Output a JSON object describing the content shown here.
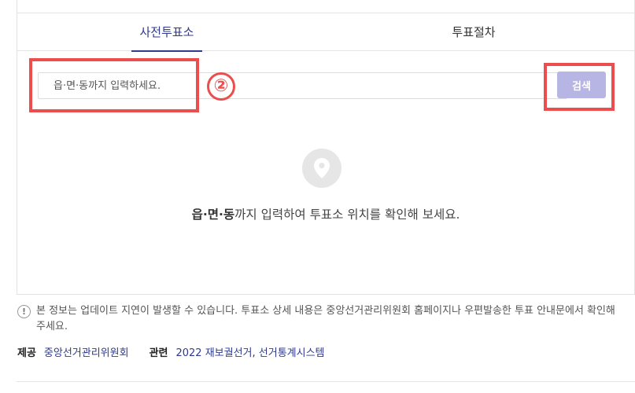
{
  "tabs": [
    {
      "label": "사전투표소",
      "active": true
    },
    {
      "label": "투표절차",
      "active": false
    }
  ],
  "search": {
    "placeholder": "읍·면·동까지 입력하세요.",
    "button_label": "검색"
  },
  "guide": {
    "bold": "읍·면·동",
    "rest": "까지 입력하여 투표소 위치를 확인해 보세요."
  },
  "annotation": {
    "number": "②",
    "color": "#ec4d4d"
  },
  "notice": {
    "icon": "!",
    "text": "본 정보는 업데이트 지연이 발생할 수 있습니다. 투표소 상세 내용은 중앙선거관리위원회 홈페이지나 우편발송한 투표 안내문에서 확인해 주세요."
  },
  "footer": {
    "provider_label": "제공",
    "provider": "중앙선거관리위원회",
    "related_label": "관련",
    "related_1": "2022 재보궐선거",
    "separator": ",",
    "related_2": "선거통계시스템"
  },
  "colors": {
    "accent": "#2f3a8f",
    "button_bg": "#b7b5e4",
    "annotation": "#ec4d4d"
  }
}
